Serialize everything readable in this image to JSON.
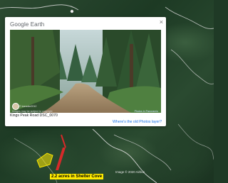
{
  "popup": {
    "brand": "Google Earth",
    "close_glyph": "×",
    "photo": {
      "credit": "© karaoke2012",
      "note": "Images may be subject to copyright",
      "source": "Photos in Panoramio"
    },
    "caption": "Kings Peak Road DSC_0070",
    "old_photos_link": "Where's the old Photos layer?"
  },
  "map": {
    "copyright": "Image © 2020 Airbus",
    "place_label": "2.2 acres in Shelter Cove",
    "colors": {
      "terrain_dark": "#1f3a26",
      "road": "#d9d9d9",
      "parcel_fill": "#ffea00",
      "pointer": "#d62a2a",
      "label_bg": "#ffea00"
    }
  }
}
